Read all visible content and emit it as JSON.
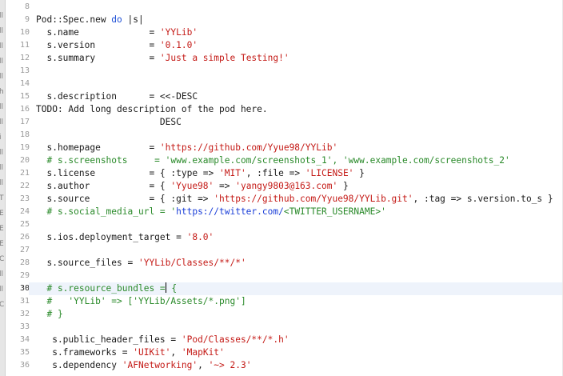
{
  "colors": {
    "string": "#c41a16",
    "keyword": "#1d4fd6",
    "comment": "#2a8a2a",
    "plain": "#1a1a1a",
    "line_number": "#9a9a9a",
    "current_line_bg": "#eef3fb"
  },
  "editor": {
    "current_line": 30,
    "left_strip_glyphs": [
      "ll",
      "ll",
      "ll",
      "ll",
      "ll",
      "h",
      "ll",
      "ll",
      "i",
      "ll",
      "ll",
      "ll",
      "T",
      "E",
      "E",
      "E",
      "C",
      "ll",
      "ll",
      "C"
    ],
    "lines": [
      {
        "number": "8",
        "tokens": []
      },
      {
        "number": "9",
        "tokens": [
          {
            "t": "plain",
            "v": "Pod::Spec.new "
          },
          {
            "t": "keyword",
            "v": "do"
          },
          {
            "t": "plain",
            "v": " |s|"
          }
        ]
      },
      {
        "number": "10",
        "tokens": [
          {
            "t": "plain",
            "v": "  s.name             = "
          },
          {
            "t": "string",
            "v": "'YYLib'"
          }
        ]
      },
      {
        "number": "11",
        "tokens": [
          {
            "t": "plain",
            "v": "  s.version          = "
          },
          {
            "t": "string",
            "v": "'0.1.0'"
          }
        ]
      },
      {
        "number": "12",
        "tokens": [
          {
            "t": "plain",
            "v": "  s.summary          = "
          },
          {
            "t": "string",
            "v": "'Just a simple Testing!'"
          }
        ]
      },
      {
        "number": "13",
        "tokens": []
      },
      {
        "number": "14",
        "tokens": []
      },
      {
        "number": "15",
        "tokens": [
          {
            "t": "plain",
            "v": "  s.description      = <<-DESC"
          }
        ]
      },
      {
        "number": "16",
        "tokens": [
          {
            "t": "plain",
            "v": "TODO: Add long description of the pod here."
          }
        ]
      },
      {
        "number": "17",
        "tokens": [
          {
            "t": "plain",
            "v": "                       DESC"
          }
        ]
      },
      {
        "number": "18",
        "tokens": []
      },
      {
        "number": "19",
        "tokens": [
          {
            "t": "plain",
            "v": "  s.homepage         = "
          },
          {
            "t": "string",
            "v": "'https://github.com/Yyue98/YYLib'"
          }
        ]
      },
      {
        "number": "20",
        "tokens": [
          {
            "t": "comment",
            "v": "  # s.screenshots     = 'www.example.com/screenshots_1', 'www.example.com/screenshots_2'"
          }
        ]
      },
      {
        "number": "21",
        "tokens": [
          {
            "t": "plain",
            "v": "  s.license          = { :type => "
          },
          {
            "t": "string",
            "v": "'MIT'"
          },
          {
            "t": "plain",
            "v": ", :file => "
          },
          {
            "t": "string",
            "v": "'LICENSE'"
          },
          {
            "t": "plain",
            "v": " }"
          }
        ]
      },
      {
        "number": "22",
        "tokens": [
          {
            "t": "plain",
            "v": "  s.author           = { "
          },
          {
            "t": "string",
            "v": "'Yyue98'"
          },
          {
            "t": "plain",
            "v": " => "
          },
          {
            "t": "string",
            "v": "'yangy9803@163.com'"
          },
          {
            "t": "plain",
            "v": " }"
          }
        ]
      },
      {
        "number": "23",
        "tokens": [
          {
            "t": "plain",
            "v": "  s.source           = { :git => "
          },
          {
            "t": "string",
            "v": "'https://github.com/Yyue98/YYLib.git'"
          },
          {
            "t": "plain",
            "v": ", :tag => s.version.to_s }"
          }
        ]
      },
      {
        "number": "24",
        "tokens": [
          {
            "t": "comment",
            "v": "  # s.social_media_url = '"
          },
          {
            "t": "link",
            "v": "https://twitter.com/"
          },
          {
            "t": "comment",
            "v": "<TWITTER_USERNAME>'"
          }
        ]
      },
      {
        "number": "25",
        "tokens": []
      },
      {
        "number": "26",
        "tokens": [
          {
            "t": "plain",
            "v": "  s.ios.deployment_target = "
          },
          {
            "t": "string",
            "v": "'8.0'"
          }
        ]
      },
      {
        "number": "27",
        "tokens": []
      },
      {
        "number": "28",
        "tokens": [
          {
            "t": "plain",
            "v": "  s.source_files = "
          },
          {
            "t": "string",
            "v": "'YYLib/Classes/**/*'"
          }
        ]
      },
      {
        "number": "29",
        "tokens": []
      },
      {
        "number": "30",
        "tokens": [
          {
            "t": "comment",
            "v": "  # s.resource_bundles ="
          },
          {
            "t": "caret",
            "v": ""
          },
          {
            "t": "comment",
            "v": " {"
          }
        ]
      },
      {
        "number": "31",
        "tokens": [
          {
            "t": "comment",
            "v": "  #   'YYLib' => ['YYLib/Assets/*.png']"
          }
        ]
      },
      {
        "number": "32",
        "tokens": [
          {
            "t": "comment",
            "v": "  # }"
          }
        ]
      },
      {
        "number": "33",
        "tokens": []
      },
      {
        "number": "34",
        "tokens": [
          {
            "t": "plain",
            "v": "   s.public_header_files = "
          },
          {
            "t": "string",
            "v": "'Pod/Classes/**/*.h'"
          }
        ]
      },
      {
        "number": "35",
        "tokens": [
          {
            "t": "plain",
            "v": "   s.frameworks = "
          },
          {
            "t": "string",
            "v": "'UIKit'"
          },
          {
            "t": "plain",
            "v": ", "
          },
          {
            "t": "string",
            "v": "'MapKit'"
          }
        ]
      },
      {
        "number": "36",
        "tokens": [
          {
            "t": "plain",
            "v": "   s.dependency "
          },
          {
            "t": "string",
            "v": "'AFNetworking'"
          },
          {
            "t": "plain",
            "v": ", "
          },
          {
            "t": "string",
            "v": "'~> 2.3'"
          }
        ]
      }
    ]
  }
}
